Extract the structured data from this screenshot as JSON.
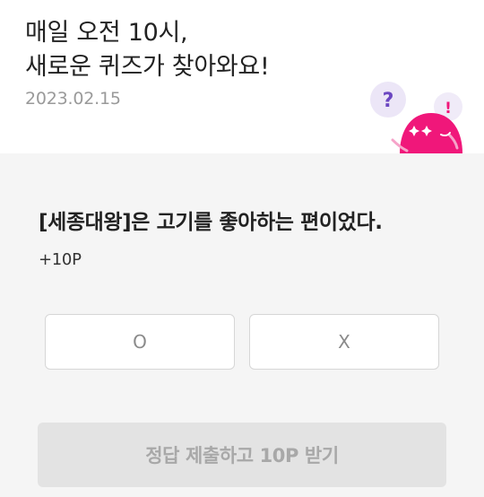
{
  "header": {
    "title_line1": "매일 오전 10시,",
    "title_line2": "새로운 퀴즈가 찾아와요!",
    "date": "2023.02.15"
  },
  "mascot": {
    "bubble_question": "?",
    "bubble_exclaim": "!",
    "colors": {
      "body": "#f0177a",
      "question_bubble": "#ece6f7",
      "question_mark": "#6b46c1",
      "exclaim_bubble": "#f0ebf8"
    }
  },
  "quiz": {
    "question": "[세종대왕]은 고기를 좋아하는 편이었다.",
    "points": "+10P",
    "options": [
      "O",
      "X"
    ],
    "submit_label": "정답 제출하고 10P 받기"
  },
  "colors": {
    "page_background": "#ffffff",
    "content_background": "#f5f5f5",
    "submit_disabled_background": "#e3e3e3",
    "submit_disabled_text": "#a8a8a8",
    "answer_border": "#d6d6d6"
  }
}
